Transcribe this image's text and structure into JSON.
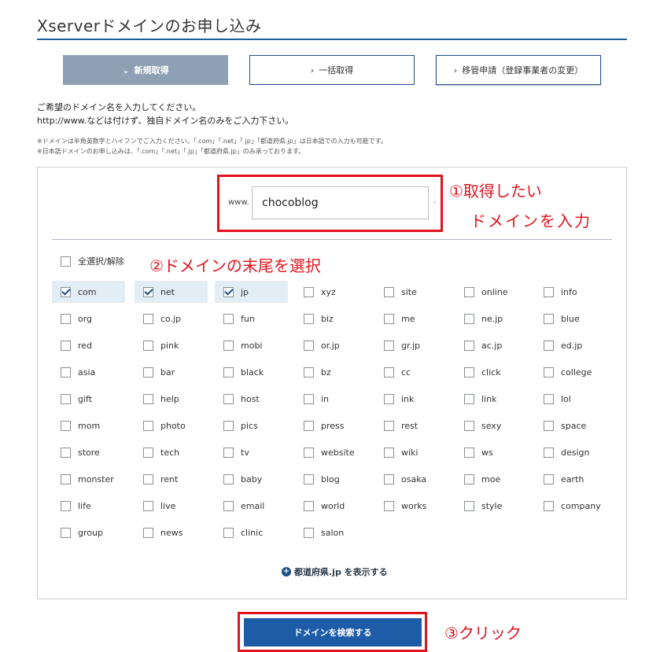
{
  "page": {
    "title": "Xserverドメインのお申し込み"
  },
  "tabs": [
    {
      "label": "新規取得",
      "active": true,
      "chevron": "⌄"
    },
    {
      "label": "一括取得",
      "active": false,
      "chevron": "›"
    },
    {
      "label": "移管申請（登録事業者の変更）",
      "active": false,
      "chevron": "›"
    }
  ],
  "intro": {
    "line1": "ご希望のドメイン名を入力してください。",
    "line2": "http://www.などは付けず、独自ドメイン名のみをご入力下さい。"
  },
  "notes": {
    "note1": "※ドメインは半角英数字とハイフンでご入力ください。「.com」「.net」「.jp」「都道府県.jp」は日本語での入力も可能です。",
    "note2": "※日本語ドメインのお申し込みは、「.com」「.net」「.jp」「都道府県.jp」のみ承っております。"
  },
  "search": {
    "prefix": "www.",
    "value": "chocoblog",
    "suffix_dot": "."
  },
  "select_all": {
    "label": "全選択/解除",
    "checked": false
  },
  "tlds": [
    {
      "label": "com",
      "checked": true
    },
    {
      "label": "net",
      "checked": true
    },
    {
      "label": "jp",
      "checked": true
    },
    {
      "label": "xyz",
      "checked": false
    },
    {
      "label": "site",
      "checked": false
    },
    {
      "label": "online",
      "checked": false
    },
    {
      "label": "info",
      "checked": false
    },
    {
      "label": "org",
      "checked": false
    },
    {
      "label": "co.jp",
      "checked": false
    },
    {
      "label": "fun",
      "checked": false
    },
    {
      "label": "biz",
      "checked": false
    },
    {
      "label": "me",
      "checked": false
    },
    {
      "label": "ne.jp",
      "checked": false
    },
    {
      "label": "blue",
      "checked": false
    },
    {
      "label": "red",
      "checked": false
    },
    {
      "label": "pink",
      "checked": false
    },
    {
      "label": "mobi",
      "checked": false
    },
    {
      "label": "or.jp",
      "checked": false
    },
    {
      "label": "gr.jp",
      "checked": false
    },
    {
      "label": "ac.jp",
      "checked": false
    },
    {
      "label": "ed.jp",
      "checked": false
    },
    {
      "label": "asia",
      "checked": false
    },
    {
      "label": "bar",
      "checked": false
    },
    {
      "label": "black",
      "checked": false
    },
    {
      "label": "bz",
      "checked": false
    },
    {
      "label": "cc",
      "checked": false
    },
    {
      "label": "click",
      "checked": false
    },
    {
      "label": "college",
      "checked": false
    },
    {
      "label": "gift",
      "checked": false
    },
    {
      "label": "help",
      "checked": false
    },
    {
      "label": "host",
      "checked": false
    },
    {
      "label": "in",
      "checked": false
    },
    {
      "label": "ink",
      "checked": false
    },
    {
      "label": "link",
      "checked": false
    },
    {
      "label": "lol",
      "checked": false
    },
    {
      "label": "mom",
      "checked": false
    },
    {
      "label": "photo",
      "checked": false
    },
    {
      "label": "pics",
      "checked": false
    },
    {
      "label": "press",
      "checked": false
    },
    {
      "label": "rest",
      "checked": false
    },
    {
      "label": "sexy",
      "checked": false
    },
    {
      "label": "space",
      "checked": false
    },
    {
      "label": "store",
      "checked": false
    },
    {
      "label": "tech",
      "checked": false
    },
    {
      "label": "tv",
      "checked": false
    },
    {
      "label": "website",
      "checked": false
    },
    {
      "label": "wiki",
      "checked": false
    },
    {
      "label": "ws",
      "checked": false
    },
    {
      "label": "design",
      "checked": false
    },
    {
      "label": "monster",
      "checked": false
    },
    {
      "label": "rent",
      "checked": false
    },
    {
      "label": "baby",
      "checked": false
    },
    {
      "label": "blog",
      "checked": false
    },
    {
      "label": "osaka",
      "checked": false
    },
    {
      "label": "moe",
      "checked": false
    },
    {
      "label": "earth",
      "checked": false
    },
    {
      "label": "life",
      "checked": false
    },
    {
      "label": "live",
      "checked": false
    },
    {
      "label": "email",
      "checked": false
    },
    {
      "label": "world",
      "checked": false
    },
    {
      "label": "works",
      "checked": false
    },
    {
      "label": "style",
      "checked": false
    },
    {
      "label": "company",
      "checked": false
    },
    {
      "label": "group",
      "checked": false
    },
    {
      "label": "news",
      "checked": false
    },
    {
      "label": "clinic",
      "checked": false
    },
    {
      "label": "salon",
      "checked": false
    }
  ],
  "show_prefecture": {
    "icon": "+",
    "label": "都道府県.jp を表示する"
  },
  "search_button": {
    "label": "ドメインを検索する"
  },
  "annotations": {
    "step1_line1": "①取得したい",
    "step1_line2": "ドメインを入力",
    "step2": "②ドメインの末尾を選択",
    "step3": "③クリック"
  },
  "colors": {
    "accent": "#1e5ca8",
    "active_tab": "#8ea0b4",
    "annotation_red": "#e0141e",
    "checked_bg": "#e3edf6"
  }
}
